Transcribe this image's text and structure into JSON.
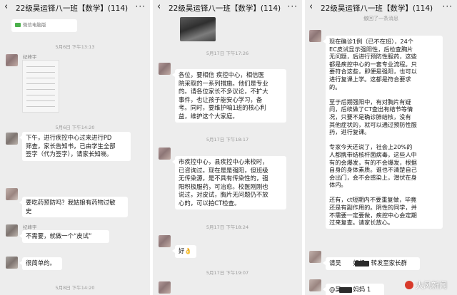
{
  "header": {
    "title": "22级昊运铎八一班【数学】(114)",
    "back_icon": "‹",
    "more_icon": "···"
  },
  "panel1": {
    "top_note": "微信电脑版",
    "times": [
      "5月6日 下午13:13",
      "5月6日 下午14:20",
      "5月8日 下午14:20"
    ],
    "sender": "纪峰宇",
    "messages": [
      [
        "下午，进行疾控中心过来进行PD",
        "筛查，家长告知书，已由学生全部",
        "签字（代为签字），请家长知晓。"
      ],
      [
        "要吃药预防吗？我姑娘有药物过敏",
        "史"
      ],
      [
        "不需要，就做一个“皮试”"
      ],
      [
        "很简单的。"
      ]
    ]
  },
  "panel2": {
    "times": [
      "5月17日 下午17:26",
      "5月17日 下午18:17",
      "5月17日 下午18:24",
      "5月17日 下午19:07"
    ],
    "messages": [
      [
        "各位，要相信 疾控中心，相信医",
        "院采取的一系列措施。他们是专业",
        "的。请各位家长不多议论，不扩大",
        "事件，也让孩子能安心学习，备",
        "考。同时，要维护咱1班的核心利",
        "益，维护这个大家庭。"
      ],
      [
        "市疾控中心，县疾控中心来校时，",
        "已咨询过。现在是是强阳，但班级",
        "无传染源，是不具有传染性的，强",
        "阳积极服药，可治愈。校医刚刚也",
        "说过，对皮试，胸片无问题仍不放",
        "心的，可以拍CT检查。"
      ],
      [
        "好👌"
      ]
    ]
  },
  "panel3": {
    "recall_note": "撤回了一条消息",
    "messages": [
      [
        "现在确诊1例（已不在班），24个",
        "EC皮试显示强阳性，后检查胸片",
        "无问题，后进行预防性服药，这些",
        "都是疾控中心的一套专业流程。只",
        "要符合这些，即便是强阳，也可以",
        "进行复课上学。这都是符合要求",
        "的。",
        "",
        "至于后期强阳中，有对胸片有疑",
        "问，后续做了CT查出有结节等情",
        "况，只要不是确诊肺结核，没有",
        "其他症状的，就可以通过预防性服",
        "药，进行复课。",
        "",
        "专家今天还说了，社会上20%的",
        "人都携带结核杆菌病毒，这些人中",
        "有的会爆发，有的不会爆发，根据",
        "自身的身体素质。谁也不清楚自己",
        "会出门，会不会感染上，潜伏在身",
        "体内。",
        "",
        "还有，ct短期内不要重复做，毕竟",
        "还是有副作用的。阴性的同学，并",
        "不需要一定要做，疾控中心会定期",
        "过来复查。请家长放心。"
      ],
      [
        "请吴　　妈妈，转发至家长群"
      ],
      [
        "@吴　　妈妈 1"
      ]
    ]
  },
  "watermark": "大风新闻"
}
